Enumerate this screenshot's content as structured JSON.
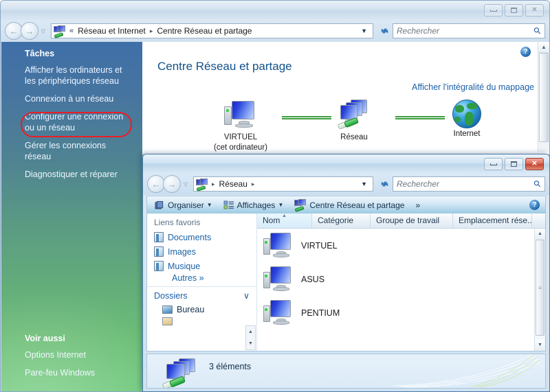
{
  "window1": {
    "titlebar": {
      "minimize": "minimize-button",
      "maximize": "maximize-button",
      "close": "close-button"
    },
    "nav": {
      "back": "←",
      "forward": "→",
      "recent_caret": "▽",
      "breadcrumb_chevrons": "«",
      "crumb1": "Réseau et Internet",
      "crumb_sep": "▸",
      "crumb2": "Centre Réseau et partage",
      "address_caret": "▼",
      "refresh": "↻",
      "search_placeholder": "Rechercher",
      "search_value": ""
    },
    "sidebar": {
      "tasks_heading": "Tâches",
      "tasks": [
        "Afficher les ordinateurs et les périphériques réseau",
        "Connexion à un réseau",
        "Configurer une connexion ou un réseau",
        "Gérer les connexions réseau",
        "Diagnostiquer et réparer"
      ],
      "highlight_color": "#ee1c24",
      "seealso_heading": "Voir aussi",
      "seealso": [
        "Options Internet",
        "Pare-feu Windows"
      ]
    },
    "content": {
      "help": "?",
      "page_title": "Centre Réseau et partage",
      "map_link": "Afficher l'intégralité du mappage",
      "nodes": [
        {
          "label": "VIRTUEL",
          "sublabel": "(cet ordinateur)",
          "icon": "computer-icon"
        },
        {
          "label": "Réseau",
          "sublabel": "",
          "icon": "network-icon"
        },
        {
          "label": "Internet",
          "sublabel": "",
          "icon": "globe-icon"
        }
      ],
      "link_color": "#3f9e3f",
      "scroll_up": "▲"
    }
  },
  "window2": {
    "titlebar": {
      "minimize": "minimize-button",
      "maximize": "maximize-button",
      "close": "close-button"
    },
    "nav": {
      "back": "←",
      "forward": "→",
      "recent_caret": "▽",
      "crumb1": "Réseau",
      "crumb_sep_left": "▸",
      "crumb_sep_right": "▸",
      "address_caret": "▼",
      "refresh": "↻",
      "search_placeholder": "Rechercher",
      "search_value": ""
    },
    "toolbar": {
      "organize": "Organiser",
      "views": "Affichages",
      "network_center": "Centre Réseau et partage",
      "overflow": "»",
      "help": "?",
      "caret": "▼"
    },
    "navpane": {
      "favorites_heading": "Liens favoris",
      "favorites": [
        "Documents",
        "Images",
        "Musique"
      ],
      "more": "Autres",
      "more_chevrons": "»",
      "folders_heading": "Dossiers",
      "folders_caret": "∨",
      "folders": [
        "Bureau"
      ],
      "scroll_up": "▲",
      "scroll_down": "▼"
    },
    "list": {
      "columns": [
        "Nom",
        "Catégorie",
        "Groupe de travail",
        "Emplacement rése..."
      ],
      "sorted_column": "Nom",
      "sort_indicator": "▲",
      "rows": [
        {
          "name": "VIRTUEL",
          "category": "",
          "workgroup": "",
          "location": ""
        },
        {
          "name": "ASUS",
          "category": "",
          "workgroup": "",
          "location": ""
        },
        {
          "name": "PENTIUM",
          "category": "",
          "workgroup": "",
          "location": ""
        }
      ],
      "scroll_up": "▲",
      "scroll_down": "▼",
      "thumb_grip": "≡"
    },
    "status": {
      "text": "3 éléments",
      "icon": "network-computers-icon"
    }
  }
}
